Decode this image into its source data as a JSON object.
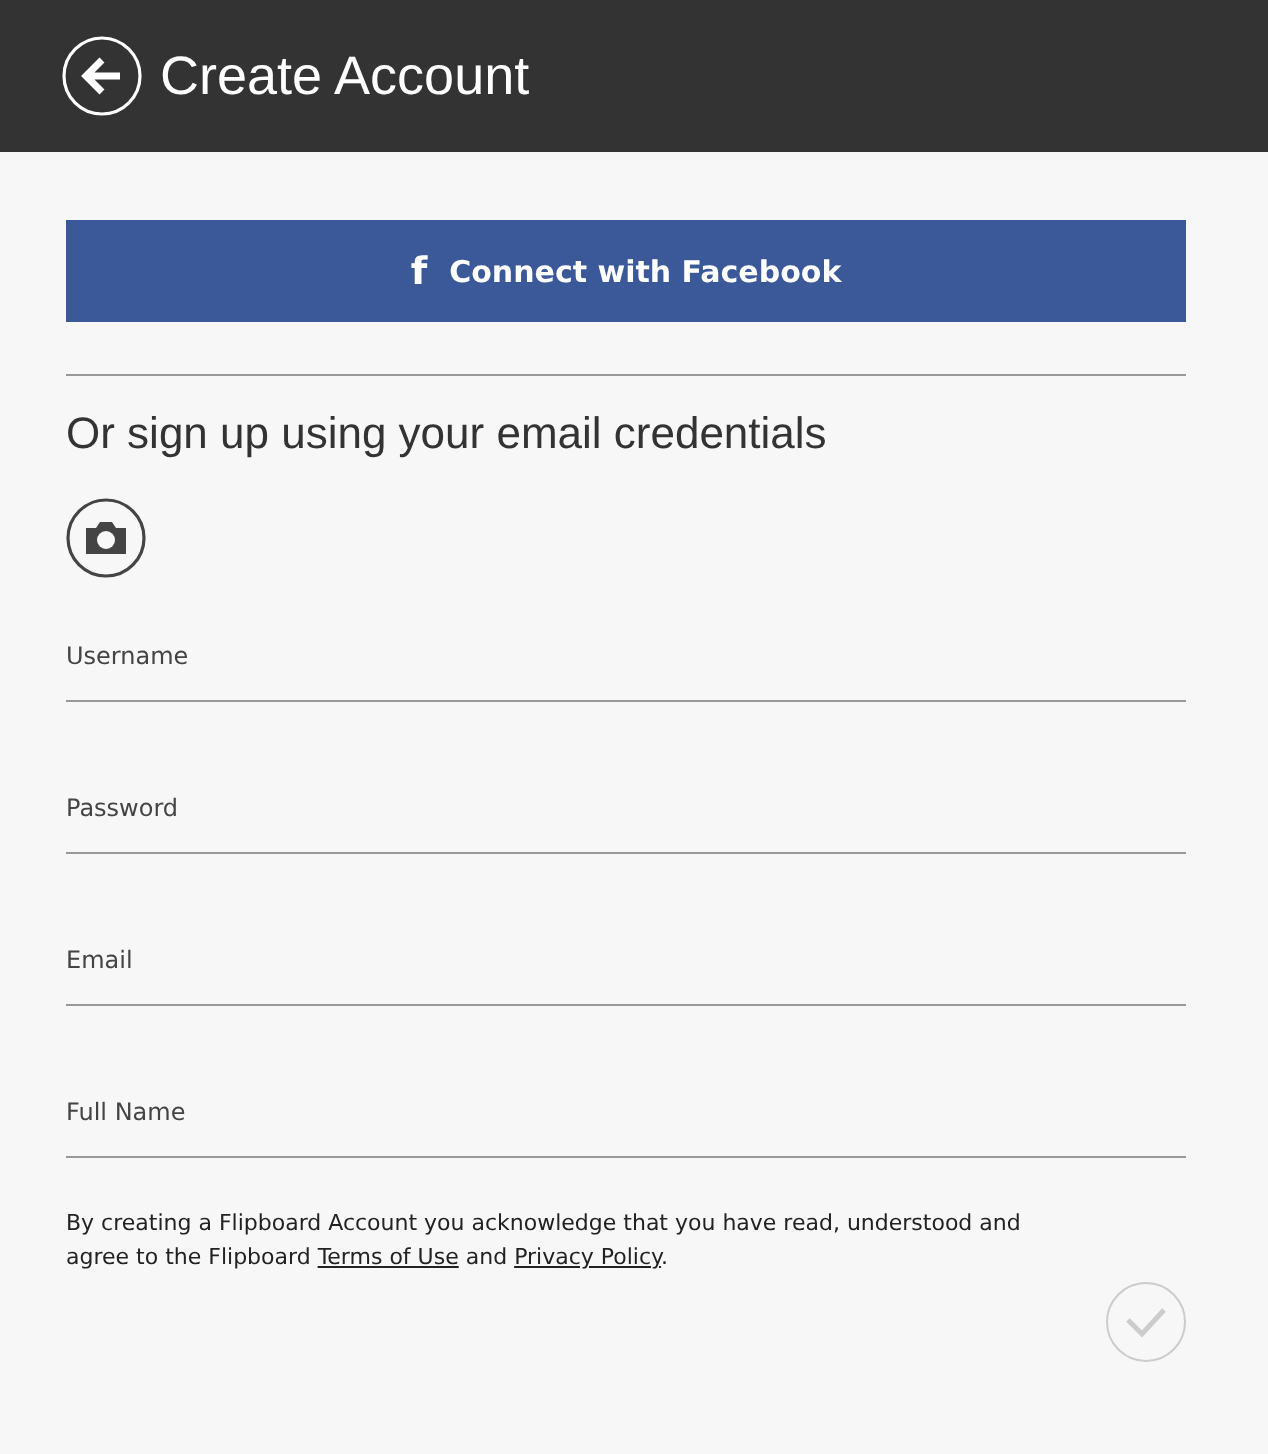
{
  "header": {
    "title": "Create Account"
  },
  "facebook_button": {
    "label": "Connect with Facebook",
    "icon_text": "f"
  },
  "subtitle": "Or sign up using your email credentials",
  "fields": [
    {
      "placeholder": "Username"
    },
    {
      "placeholder": "Password"
    },
    {
      "placeholder": "Email"
    },
    {
      "placeholder": "Full Name"
    }
  ],
  "disclaimer": [
    {
      "kind": "text",
      "text": "By creating a Flipboard Account you acknowledge that you have read, understood and agree to the Flipboard "
    },
    {
      "kind": "link",
      "text": "Terms of Use"
    },
    {
      "kind": "text",
      "text": " and "
    },
    {
      "kind": "link",
      "text": "Privacy Policy"
    },
    {
      "kind": "text",
      "text": "."
    }
  ],
  "submit": {
    "disabled": true
  }
}
